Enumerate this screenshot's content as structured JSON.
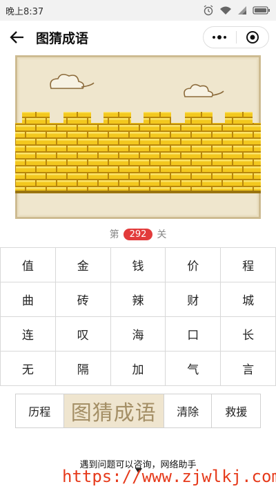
{
  "status_bar": {
    "time": "晚上8:37"
  },
  "header": {
    "title": "图猜成语"
  },
  "level": {
    "prefix": "第",
    "number": "292",
    "suffix": "关"
  },
  "grid": {
    "chars": [
      "值",
      "金",
      "钱",
      "价",
      "程",
      "曲",
      "砖",
      "辣",
      "财",
      "城",
      "连",
      "叹",
      "海",
      "口",
      "长",
      "无",
      "隔",
      "加",
      "气",
      "言"
    ]
  },
  "actions": {
    "history": "历程",
    "answer_placeholder": "图猜成语",
    "clear": "清除",
    "rescue": "救援"
  },
  "footer": {
    "help": "遇到问题可以咨询，网络助手",
    "watermark": "https://www.zjwlkj.com"
  },
  "colors": {
    "level_badge": "#e23b3b",
    "answer_bg": "#efe5cf",
    "wall": "#f1c51f"
  }
}
